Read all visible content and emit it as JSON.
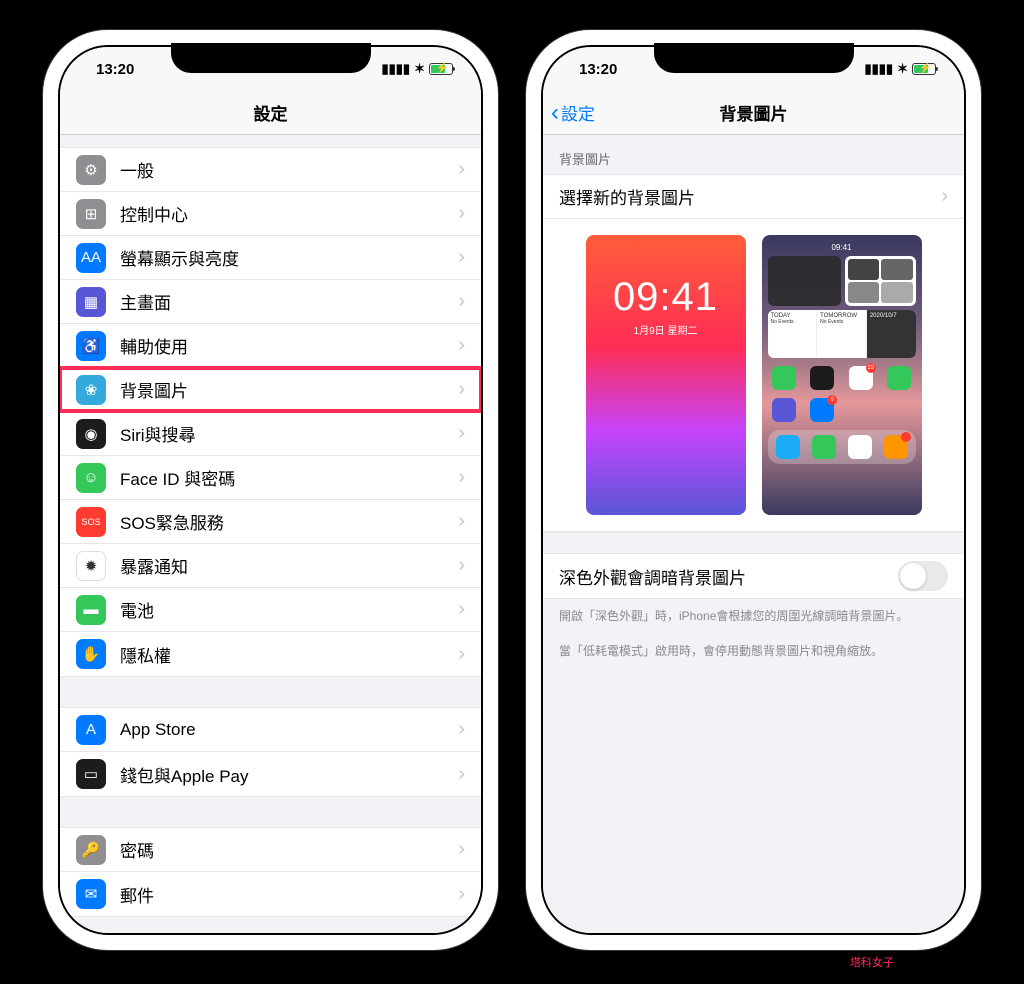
{
  "status": {
    "time": "13:20"
  },
  "left": {
    "nav_title": "設定",
    "groups": [
      {
        "rows": [
          {
            "icon": "gear-icon",
            "bg": "bg-gray",
            "glyph": "⚙",
            "label": "一般"
          },
          {
            "icon": "control-center-icon",
            "bg": "bg-gray2",
            "glyph": "⊞",
            "label": "控制中心"
          },
          {
            "icon": "display-icon",
            "bg": "bg-blue",
            "glyph": "AA",
            "label": "螢幕顯示與亮度"
          },
          {
            "icon": "home-screen-icon",
            "bg": "bg-purple",
            "glyph": "▦",
            "label": "主畫面"
          },
          {
            "icon": "accessibility-icon",
            "bg": "bg-blue",
            "glyph": "♿",
            "label": "輔助使用"
          },
          {
            "icon": "wallpaper-icon",
            "bg": "bg-cyan",
            "glyph": "❀",
            "label": "背景圖片",
            "highlight": true
          },
          {
            "icon": "siri-icon",
            "bg": "bg-black",
            "glyph": "◉",
            "label": "Siri與搜尋"
          },
          {
            "icon": "faceid-icon",
            "bg": "bg-green",
            "glyph": "☺",
            "label": "Face ID 與密碼"
          },
          {
            "icon": "sos-icon",
            "bg": "bg-red",
            "glyph": "SOS",
            "label": "SOS緊急服務"
          },
          {
            "icon": "exposure-icon",
            "bg": "bg-white",
            "glyph": "✹",
            "label": "暴露通知"
          },
          {
            "icon": "battery-icon",
            "bg": "bg-green",
            "glyph": "▬",
            "label": "電池"
          },
          {
            "icon": "privacy-icon",
            "bg": "bg-blue",
            "glyph": "✋",
            "label": "隱私權"
          }
        ]
      },
      {
        "rows": [
          {
            "icon": "appstore-icon",
            "bg": "bg-blue",
            "glyph": "A",
            "label": "App Store"
          },
          {
            "icon": "wallet-icon",
            "bg": "bg-black",
            "glyph": "▭",
            "label": "錢包與Apple Pay"
          }
        ]
      },
      {
        "rows": [
          {
            "icon": "passwords-icon",
            "bg": "bg-gray",
            "glyph": "🔑",
            "label": "密碼"
          },
          {
            "icon": "mail-icon",
            "bg": "bg-blue",
            "glyph": "✉",
            "label": "郵件"
          }
        ]
      }
    ]
  },
  "right": {
    "nav_back": "設定",
    "nav_title": "背景圖片",
    "section_header": "背景圖片",
    "choose_row": "選擇新的背景圖片",
    "lock_preview": {
      "time": "09:41",
      "date": "1月9日 星期二"
    },
    "home_preview": {
      "time": "09:41"
    },
    "dark_toggle_label": "深色外觀會調暗背景圖片",
    "footer_1": "開啟「深色外觀」時，iPhone會根據您的周圍光線調暗背景圖片。",
    "footer_2": "當「低耗電模式」啟用時，會停用動態背景圖片和視角縮放。"
  },
  "watermark": "塔科女子"
}
